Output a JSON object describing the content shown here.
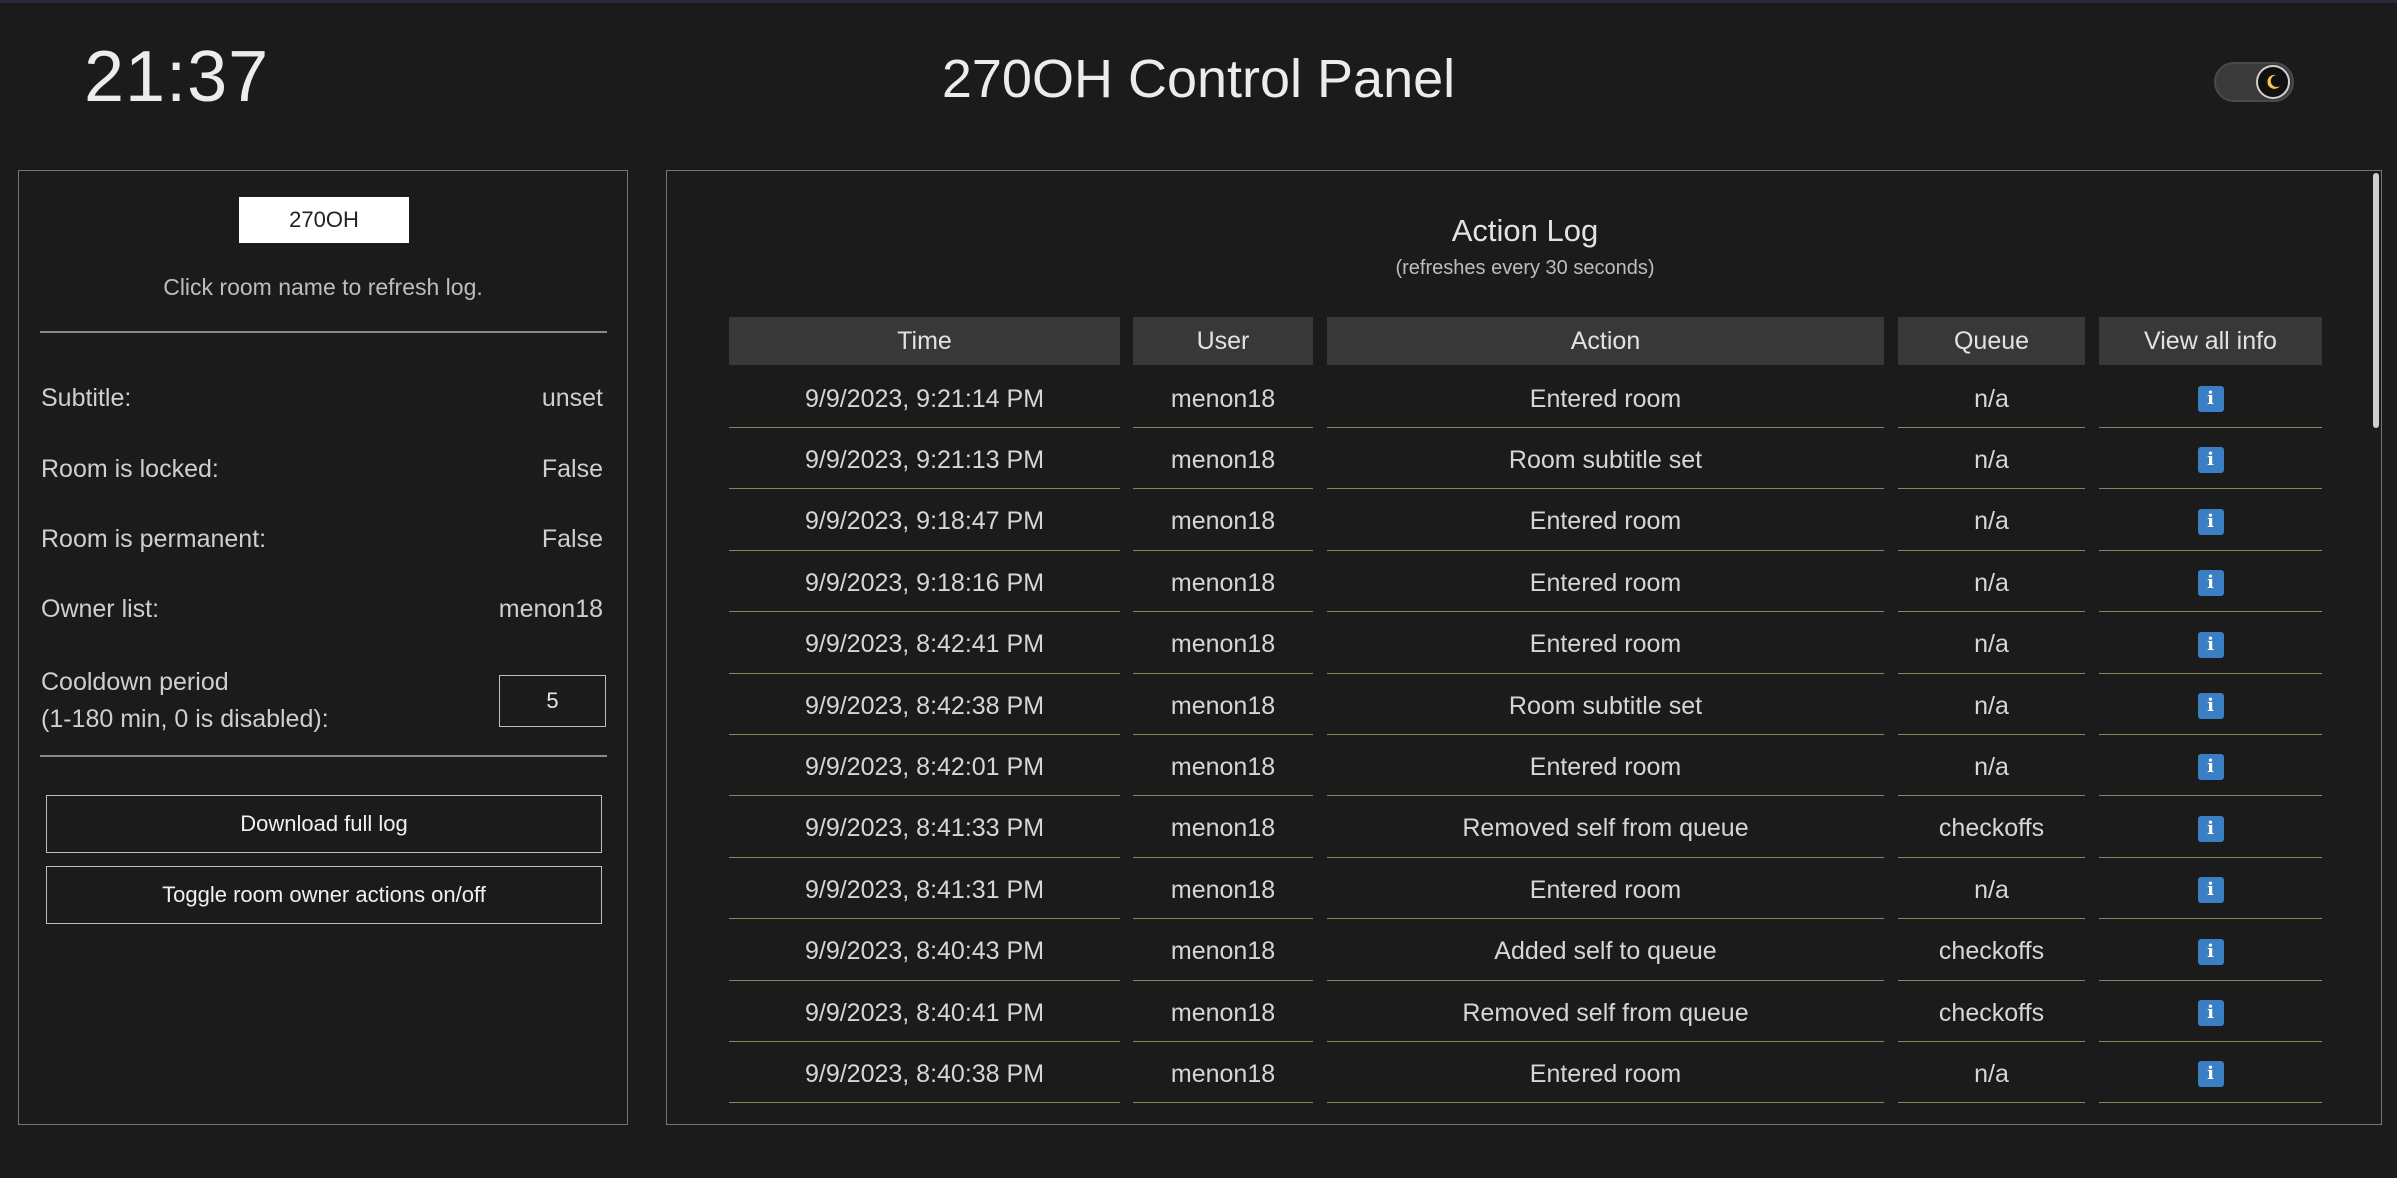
{
  "header": {
    "clock": "21:37",
    "title": "270OH Control Panel",
    "theme_toggle_icon": "moon-icon"
  },
  "left_panel": {
    "room_button_label": "270OH",
    "hint": "Click room name to refresh log.",
    "info": [
      {
        "label": "Subtitle:",
        "value": "unset"
      },
      {
        "label": "Room is locked:",
        "value": "False"
      },
      {
        "label": "Room is permanent:",
        "value": "False"
      },
      {
        "label": "Owner list:",
        "value": "menon18"
      }
    ],
    "cooldown_label_line1": "Cooldown period",
    "cooldown_label_line2": "(1-180 min, 0 is disabled):",
    "cooldown_value": "5",
    "download_button": "Download full log",
    "toggle_button": "Toggle room owner actions on/off"
  },
  "action_log": {
    "title": "Action Log",
    "subtitle": "(refreshes every 30 seconds)",
    "columns": [
      "Time",
      "User",
      "Action",
      "Queue",
      "View all info"
    ],
    "rows": [
      [
        "9/9/2023, 9:21:14 PM",
        "menon18",
        "Entered room",
        "n/a"
      ],
      [
        "9/9/2023, 9:21:13 PM",
        "menon18",
        "Room subtitle set",
        "n/a"
      ],
      [
        "9/9/2023, 9:18:47 PM",
        "menon18",
        "Entered room",
        "n/a"
      ],
      [
        "9/9/2023, 9:18:16 PM",
        "menon18",
        "Entered room",
        "n/a"
      ],
      [
        "9/9/2023, 8:42:41 PM",
        "menon18",
        "Entered room",
        "n/a"
      ],
      [
        "9/9/2023, 8:42:38 PM",
        "menon18",
        "Room subtitle set",
        "n/a"
      ],
      [
        "9/9/2023, 8:42:01 PM",
        "menon18",
        "Entered room",
        "n/a"
      ],
      [
        "9/9/2023, 8:41:33 PM",
        "menon18",
        "Removed self from queue",
        "checkoffs"
      ],
      [
        "9/9/2023, 8:41:31 PM",
        "menon18",
        "Entered room",
        "n/a"
      ],
      [
        "9/9/2023, 8:40:43 PM",
        "menon18",
        "Added self to queue",
        "checkoffs"
      ],
      [
        "9/9/2023, 8:40:41 PM",
        "menon18",
        "Removed self from queue",
        "checkoffs"
      ],
      [
        "9/9/2023, 8:40:38 PM",
        "menon18",
        "Entered room",
        "n/a"
      ]
    ],
    "info_icon_label": "i"
  }
}
